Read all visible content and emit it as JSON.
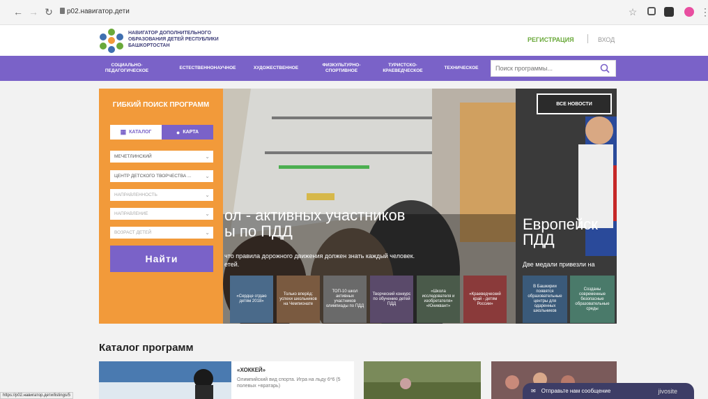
{
  "browser": {
    "url": "p02.навигатор.дети",
    "status_url": "https://p02.навигатор.дети/listings/5"
  },
  "header": {
    "logo_text": "Навигатор дополнительного образования детей Республики Башкортостан",
    "register": "Регистрация",
    "login": "Вход"
  },
  "menu": {
    "items": [
      "Социально-педагогическое",
      "Естественнонаучное",
      "Художественное",
      "Физкультурно-спортивное",
      "Туристско-краеведческое",
      "Техническое"
    ],
    "search_placeholder": "Поиск программы..."
  },
  "filter": {
    "title": "Гибкий поиск программ",
    "tab_catalog": "Каталог",
    "tab_map": "Карта",
    "selects": [
      "Мечетлинский",
      "Центр детского творчества ...",
      "Направленность",
      "Направление",
      "Возраст детей"
    ],
    "find_button": "Найти"
  },
  "slider": {
    "title_line1": "ол - активных участников",
    "title_line2": "ы по ПДД",
    "subtitle": "что правила дорожного движения должен знать каждый человек.",
    "subtitle2": "етей.",
    "all_news": "Все новости",
    "side_title_line1": "Европейск",
    "side_title_line2": "ПДД",
    "side_subtitle": "Две медали привезли на",
    "thumbs": [
      "«Сердце отдаю детям 2018»",
      "Только вперёд: успехи школьников на Чемпионате",
      "ТОП-10 школ активных участников олимпиады по ПДД",
      "Творческий конкурс по обучению детей ПДД",
      "«Школа исследователя и изобретателя» «Юниквант»",
      "«Краеведческий край - детям России»",
      "В Башкирии появятся образовательные центры для одаренных школьников",
      "Созданы современные безопасные образовательные среды"
    ]
  },
  "catalog": {
    "heading": "Каталог программ",
    "cards": [
      {
        "title": "«Хоккей»",
        "desc": "Олимпийский вид спорта. Игра на льду 6*6 (5 полевых +вратарь)"
      }
    ]
  },
  "chat": {
    "label": "Отправьте нам сообщение",
    "brand": "jivosite"
  },
  "colors": {
    "accent": "#7a62c8",
    "orange": "#f29a3a",
    "green": "#6aa93a"
  }
}
